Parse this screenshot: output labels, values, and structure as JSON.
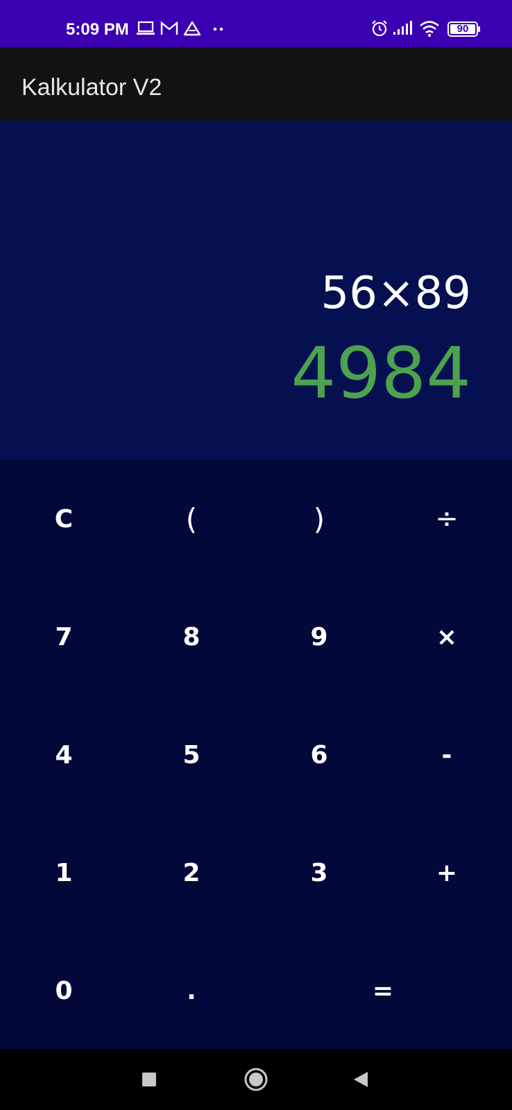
{
  "status_bar": {
    "time": "5:09 PM",
    "left_icons": [
      "laptop-icon",
      "gmail-icon",
      "drive-icon",
      "more-dots-icon"
    ],
    "right_icons": [
      "alarm-icon",
      "signal-icon",
      "wifi-icon",
      "battery-icon"
    ],
    "battery_level": "90",
    "bar_color": "#3A00B2"
  },
  "app_bar": {
    "title": "Kalkulator V2"
  },
  "display": {
    "expression": "56×89",
    "result": "4984",
    "result_color": "#4CA24E"
  },
  "keypad": {
    "rows": [
      [
        "C",
        "(",
        ")",
        "÷"
      ],
      [
        "7",
        "8",
        "9",
        "×"
      ],
      [
        "4",
        "5",
        "6",
        "-"
      ],
      [
        "1",
        "2",
        "3",
        "+"
      ],
      [
        "0",
        ".",
        "="
      ]
    ]
  },
  "nav_bar": {
    "buttons": [
      "recents-square-icon",
      "home-circle-icon",
      "back-triangle-icon"
    ]
  }
}
